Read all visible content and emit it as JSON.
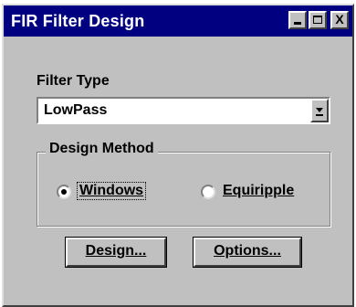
{
  "window": {
    "title": "FIR Filter Design",
    "minimize_icon": "minimize-icon",
    "maximize_icon": "maximize-icon",
    "close_label": "X"
  },
  "filter_type": {
    "label": "Filter Type",
    "selected": "LowPass",
    "dropdown_icon": "chevron-down-icon"
  },
  "design_method": {
    "legend": "Design Method",
    "options": [
      {
        "label": "Windows",
        "checked": true
      },
      {
        "label": "Equiripple",
        "checked": false
      }
    ]
  },
  "buttons": {
    "design_label": "Design...",
    "options_label": "Options..."
  }
}
